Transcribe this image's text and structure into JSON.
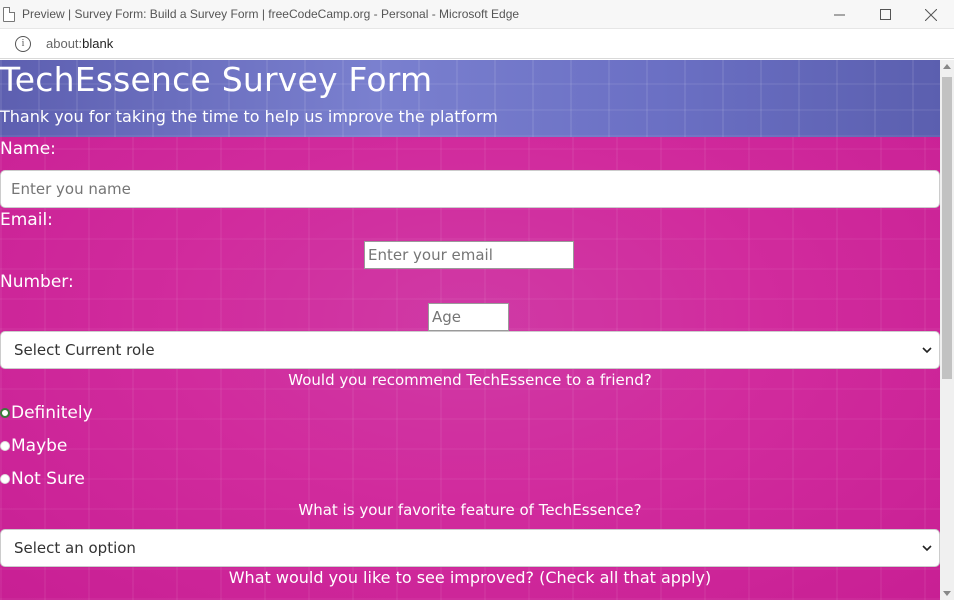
{
  "window": {
    "title": "Preview | Survey Form: Build a Survey Form | freeCodeCamp.org - Personal - Microsoft Edge",
    "address_scheme": "about:",
    "address_path": "blank"
  },
  "page": {
    "title": "TechEssence Survey Form",
    "subtitle": "Thank you for taking the time to help us improve the platform",
    "name_label": "Name:",
    "name_placeholder": "Enter you name",
    "email_label": "Email:",
    "email_placeholder": "Enter your email",
    "number_label": "Number:",
    "number_placeholder": "Age",
    "role_select": "Select Current role",
    "recommend_question": "Would you recommend TechEssence to a friend?",
    "recommend_options": [
      "Definitely",
      "Maybe",
      "Not Sure"
    ],
    "recommend_selected": "Definitely",
    "feature_question": "What is your favorite feature of TechEssence?",
    "feature_select": "Select an option",
    "improve_question": "What would you like to see improved? (Check all that apply)"
  },
  "colors": {
    "form_background": "#d12b9d",
    "header_background": "#6b70c4"
  },
  "icons": [
    "document-icon",
    "info-icon",
    "minimize-icon",
    "maximize-icon",
    "close-icon",
    "chevron-down-icon"
  ]
}
